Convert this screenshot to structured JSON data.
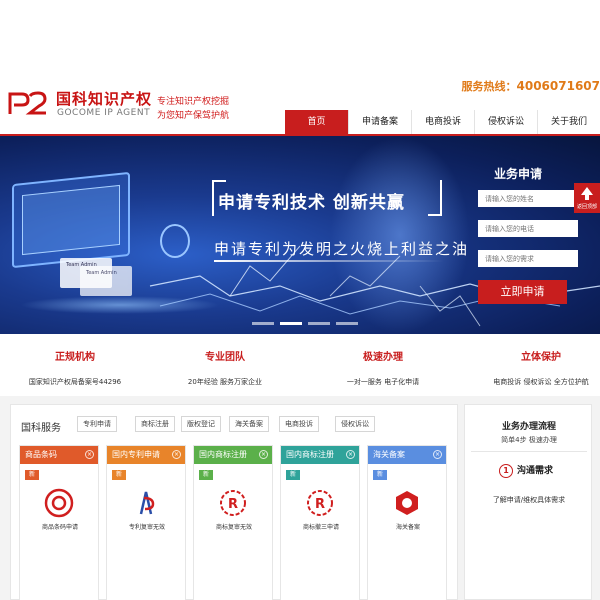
{
  "header": {
    "logo_cn": "国科知识产权",
    "logo_en": "GOCOME IP AGENT",
    "slogan_1": "专注知识产权挖掘",
    "slogan_2": "为您知产保驾护航",
    "hotline_label": "服务热线：",
    "hotline_number": "4006071607"
  },
  "nav": {
    "items": [
      "首页",
      "申请备案",
      "电商投诉",
      "侵权诉讼",
      "关于我们"
    ]
  },
  "banner": {
    "title": "申请专利技术  创新共赢",
    "subtitle": "申请专利为发明之火烧上利益之油",
    "panel_labels": [
      "Team Admin",
      "Team Admin"
    ],
    "form_title": "业务申请",
    "name_placeholder": "请输入您的姓名",
    "phone_placeholder": "请输入您的电话",
    "need_placeholder": "请输入您的需求",
    "submit_label": "立即申请",
    "float_label": "返回顶部"
  },
  "features": [
    {
      "title": "正规机构",
      "desc": "国家知识产权局备案号44296"
    },
    {
      "title": "专业团队",
      "desc": "20年经验 服务万家企业"
    },
    {
      "title": "极速办理",
      "desc": "一对一服务 电子化申请"
    },
    {
      "title": "立体保护",
      "desc": "电商投诉 侵权诉讼 全方位护航"
    }
  ],
  "services": {
    "title": "国科服务",
    "tags": [
      "专利申请",
      "商标注册",
      "版权登记",
      "海关备案",
      "电商投诉",
      "侵权诉讼"
    ],
    "cards": [
      {
        "title": "商品条码",
        "badge": "新",
        "label": "商品条码申请",
        "color": "#e05a2a"
      },
      {
        "title": "国内专利申请",
        "badge": "新",
        "label": "专利复审无效",
        "color": "#e8842a"
      },
      {
        "title": "国内商标注册",
        "badge": "新",
        "label": "商标复审无效",
        "color": "#5bb04a"
      },
      {
        "title": "国内商标注册",
        "badge": "新",
        "label": "商标撤三申请",
        "color": "#2fa39a"
      },
      {
        "title": "海关备案",
        "badge": "新",
        "label": "海关备案",
        "color": "#5a8ee0"
      }
    ]
  },
  "process": {
    "title": "业务办理流程",
    "subtitle": "简单4步 极速办理",
    "step_number": "1",
    "step_title": "沟通需求",
    "step_desc": "了解申请/维权具体需求"
  }
}
